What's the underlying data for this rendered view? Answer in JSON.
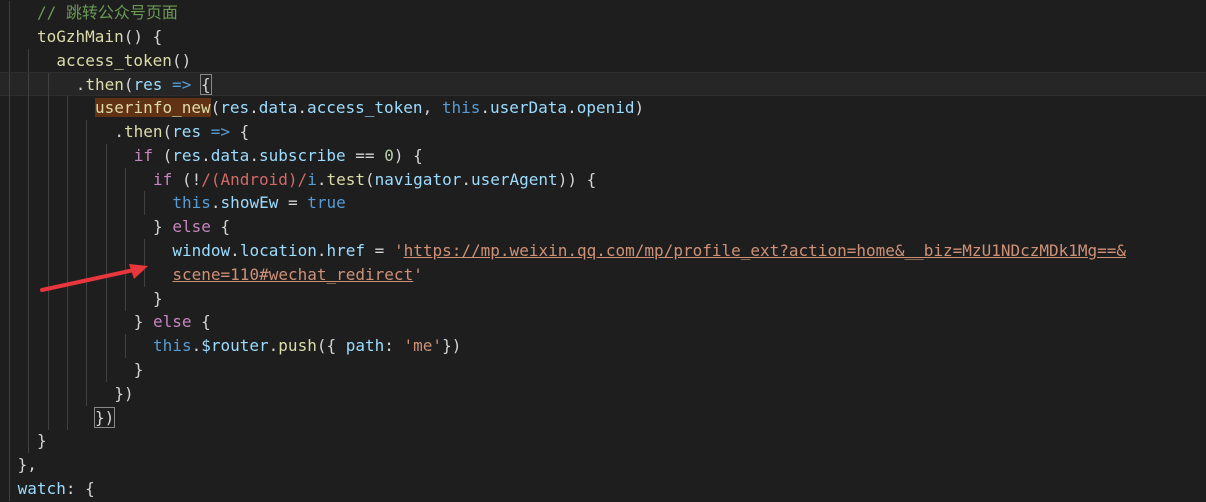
{
  "editor": {
    "colors": {
      "background": "#1e1e1e",
      "comment": "#6a9955",
      "function": "#dcdcaa",
      "variable": "#9cdcfe",
      "keyword": "#569cd6",
      "control": "#c586c0",
      "number": "#b5cea8",
      "string": "#ce9178",
      "regex": "#d16969",
      "highlight": "#613214",
      "annotation_arrow": "#e8363d"
    },
    "lines": [
      {
        "indent": 2,
        "guides": 1,
        "tokens": [
          [
            "// 跳转公众号页面",
            "t-comment"
          ]
        ]
      },
      {
        "indent": 2,
        "guides": 1,
        "tokens": [
          [
            "toGzhMain",
            "t-fn"
          ],
          [
            "() {",
            "t-plain"
          ]
        ]
      },
      {
        "indent": 3,
        "guides": 2,
        "tokens": [
          [
            "access_token",
            "t-fn"
          ],
          [
            "()",
            "t-plain"
          ]
        ]
      },
      {
        "indent": 4,
        "guides": 3,
        "current": true,
        "tokens": [
          [
            ".",
            "t-plain"
          ],
          [
            "then",
            "t-fn"
          ],
          [
            "(",
            "t-plain"
          ],
          [
            "res",
            "t-var"
          ],
          [
            " ",
            "t-plain"
          ],
          [
            "=>",
            "t-kw"
          ],
          [
            " ",
            "t-plain"
          ],
          [
            "{",
            "t-plain t-bracket-box"
          ]
        ]
      },
      {
        "indent": 5,
        "guides": 4,
        "tokens": [
          [
            "userinfo_new",
            "t-hl"
          ],
          [
            "(",
            "t-plain"
          ],
          [
            "res",
            "t-var"
          ],
          [
            ".",
            "t-plain"
          ],
          [
            "data",
            "t-var"
          ],
          [
            ".",
            "t-plain"
          ],
          [
            "access_token",
            "t-var"
          ],
          [
            ", ",
            "t-plain"
          ],
          [
            "this",
            "t-kw"
          ],
          [
            ".",
            "t-plain"
          ],
          [
            "userData",
            "t-var"
          ],
          [
            ".",
            "t-plain"
          ],
          [
            "openid",
            "t-var"
          ],
          [
            ")",
            "t-plain"
          ]
        ]
      },
      {
        "indent": 6,
        "guides": 5,
        "tokens": [
          [
            ".",
            "t-plain"
          ],
          [
            "then",
            "t-fn"
          ],
          [
            "(",
            "t-plain"
          ],
          [
            "res",
            "t-var"
          ],
          [
            " ",
            "t-plain"
          ],
          [
            "=>",
            "t-kw"
          ],
          [
            " {",
            "t-plain"
          ]
        ]
      },
      {
        "indent": 7,
        "guides": 6,
        "tokens": [
          [
            "if",
            "t-ctrl"
          ],
          [
            " (",
            "t-plain"
          ],
          [
            "res",
            "t-var"
          ],
          [
            ".",
            "t-plain"
          ],
          [
            "data",
            "t-var"
          ],
          [
            ".",
            "t-plain"
          ],
          [
            "subscribe",
            "t-var"
          ],
          [
            " == ",
            "t-plain"
          ],
          [
            "0",
            "t-num"
          ],
          [
            ") {",
            "t-plain"
          ]
        ]
      },
      {
        "indent": 8,
        "guides": 7,
        "tokens": [
          [
            "if",
            "t-ctrl"
          ],
          [
            " (!",
            "t-plain"
          ],
          [
            "/(Android)/",
            "t-regex"
          ],
          [
            "i",
            "t-kw"
          ],
          [
            ".",
            "t-plain"
          ],
          [
            "test",
            "t-fn"
          ],
          [
            "(",
            "t-plain"
          ],
          [
            "navigator",
            "t-var"
          ],
          [
            ".",
            "t-plain"
          ],
          [
            "userAgent",
            "t-var"
          ],
          [
            ")) {",
            "t-plain"
          ]
        ]
      },
      {
        "indent": 9,
        "guides": 8,
        "tokens": [
          [
            "this",
            "t-kw"
          ],
          [
            ".",
            "t-plain"
          ],
          [
            "showEw",
            "t-var"
          ],
          [
            " = ",
            "t-plain"
          ],
          [
            "true",
            "t-kw"
          ]
        ]
      },
      {
        "indent": 8,
        "guides": 7,
        "tokens": [
          [
            "} ",
            "t-plain"
          ],
          [
            "else",
            "t-ctrl"
          ],
          [
            " {",
            "t-plain"
          ]
        ]
      },
      {
        "indent": 9,
        "guides": 8,
        "tokens": [
          [
            "window",
            "t-var"
          ],
          [
            ".",
            "t-plain"
          ],
          [
            "location",
            "t-var"
          ],
          [
            ".",
            "t-plain"
          ],
          [
            "href",
            "t-var"
          ],
          [
            " = ",
            "t-plain"
          ],
          [
            "'",
            "t-str"
          ],
          [
            "https://mp.weixin.qq.com/mp/profile_ext?action=home&__biz=MzU1NDczMDk1Mg==&",
            "t-url"
          ]
        ]
      },
      {
        "indent": 9,
        "guides": 8,
        "tokens": [
          [
            "scene=110#wechat_redirect",
            "t-url"
          ],
          [
            "'",
            "t-str"
          ]
        ]
      },
      {
        "indent": 8,
        "guides": 7,
        "tokens": [
          [
            "}",
            "t-plain"
          ]
        ]
      },
      {
        "indent": 7,
        "guides": 6,
        "tokens": [
          [
            "} ",
            "t-plain"
          ],
          [
            "else",
            "t-ctrl"
          ],
          [
            " {",
            "t-plain"
          ]
        ]
      },
      {
        "indent": 8,
        "guides": 7,
        "tokens": [
          [
            "this",
            "t-kw"
          ],
          [
            ".",
            "t-plain"
          ],
          [
            "$router",
            "t-var"
          ],
          [
            ".",
            "t-plain"
          ],
          [
            "push",
            "t-fn"
          ],
          [
            "({ ",
            "t-plain"
          ],
          [
            "path",
            "t-var"
          ],
          [
            ": ",
            "t-plain"
          ],
          [
            "'me'",
            "t-str"
          ],
          [
            "})",
            "t-plain"
          ]
        ]
      },
      {
        "indent": 7,
        "guides": 6,
        "tokens": [
          [
            "}",
            "t-plain"
          ]
        ]
      },
      {
        "indent": 6,
        "guides": 5,
        "tokens": [
          [
            "})",
            "t-plain"
          ]
        ]
      },
      {
        "indent": 5,
        "guides": 4,
        "tokens": [
          [
            "})",
            "t-plain t-bracket-box"
          ]
        ]
      },
      {
        "indent": 2,
        "guides": 2,
        "tokens": [
          [
            "}",
            "t-plain"
          ]
        ]
      },
      {
        "indent": 1,
        "guides": 1,
        "tokens": [
          [
            "},",
            "t-plain"
          ]
        ]
      },
      {
        "indent": 1,
        "guides": 1,
        "tokens": [
          [
            "watch",
            "t-var"
          ],
          [
            ": {",
            "t-plain"
          ]
        ]
      }
    ]
  }
}
